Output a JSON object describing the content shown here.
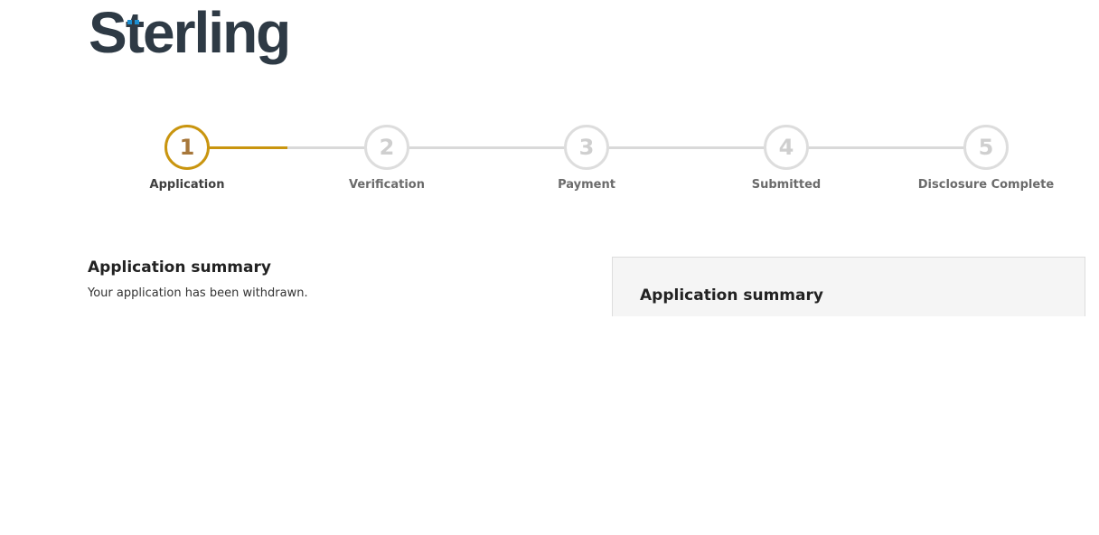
{
  "brand": {
    "logo_text_pre": "S",
    "logo_text_accent": "t",
    "logo_text_post": "erling",
    "text_color": "#2e3a45",
    "accent_color": "#1d8fd1"
  },
  "stepper": {
    "active_color": "#c9950f",
    "inactive_color": "#dddddd",
    "progress_fraction": 0.125,
    "steps": [
      {
        "number": "1",
        "label": "Application",
        "state": "active"
      },
      {
        "number": "2",
        "label": "Verification",
        "state": "inactive"
      },
      {
        "number": "3",
        "label": "Payment",
        "state": "inactive"
      },
      {
        "number": "4",
        "label": "Submitted",
        "state": "inactive"
      },
      {
        "number": "5",
        "label": "Disclosure Complete",
        "state": "inactive"
      }
    ]
  },
  "main": {
    "title": "Application summary",
    "status_message": "Your application has been withdrawn."
  },
  "side_panel": {
    "title": "Application summary"
  }
}
